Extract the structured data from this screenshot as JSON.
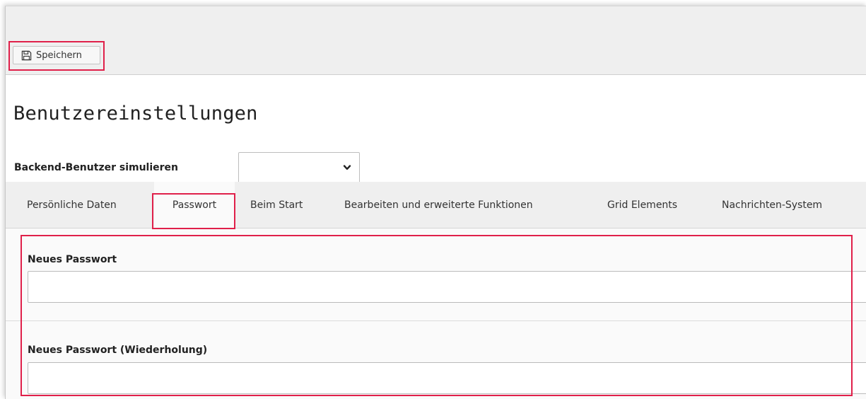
{
  "toolbar": {
    "save_label": "Speichern",
    "save_icon": "floppy-disk-icon"
  },
  "page": {
    "title": "Benutzereinstellungen"
  },
  "simulate": {
    "label": "Backend-Benutzer simulieren",
    "selected": ""
  },
  "tabs": [
    {
      "label": "Persönliche Daten",
      "active": false
    },
    {
      "label": "Passwort",
      "active": true
    },
    {
      "label": "Beim Start",
      "active": false
    },
    {
      "label": "Bearbeiten und erweiterte Funktionen",
      "active": false
    },
    {
      "label": "Grid Elements",
      "active": false
    },
    {
      "label": "Nachrichten-System",
      "active": false
    }
  ],
  "form": {
    "new_password": {
      "label": "Neues Passwort",
      "value": "",
      "placeholder": ""
    },
    "repeat_password": {
      "label": "Neues Passwort (Wiederholung)",
      "value": "",
      "placeholder": ""
    }
  },
  "colors": {
    "highlight": "#e0204a",
    "toolbar_bg": "#efefef",
    "content_bg": "#fafafa"
  }
}
